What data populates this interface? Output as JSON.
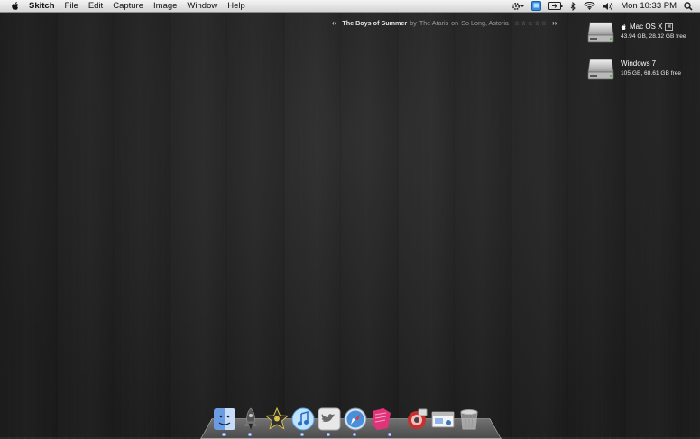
{
  "menubar": {
    "app_name": "Skitch",
    "menus": [
      "File",
      "Edit",
      "Capture",
      "Image",
      "Window",
      "Help"
    ],
    "clock": "Mon 10:33 PM"
  },
  "now_playing": {
    "prev": "‹‹",
    "title": "The Boys of Summer",
    "by": "by",
    "artist": "The Ataris",
    "on": "on",
    "album": "So Long, Astoria",
    "stars": "☆☆☆☆☆",
    "next": "››"
  },
  "drives": [
    {
      "name": "Mac OS X",
      "badge": "⌘",
      "space": "43.94 GB, 28.32 GB free"
    },
    {
      "name": "Windows 7",
      "space": "105 GB, 68.61 GB free"
    }
  ],
  "dock": {
    "items": [
      "finder",
      "rocket",
      "imovie",
      "itunes",
      "twitter",
      "safari",
      "papers",
      "photo-booth",
      "dashboard",
      "trash"
    ]
  }
}
